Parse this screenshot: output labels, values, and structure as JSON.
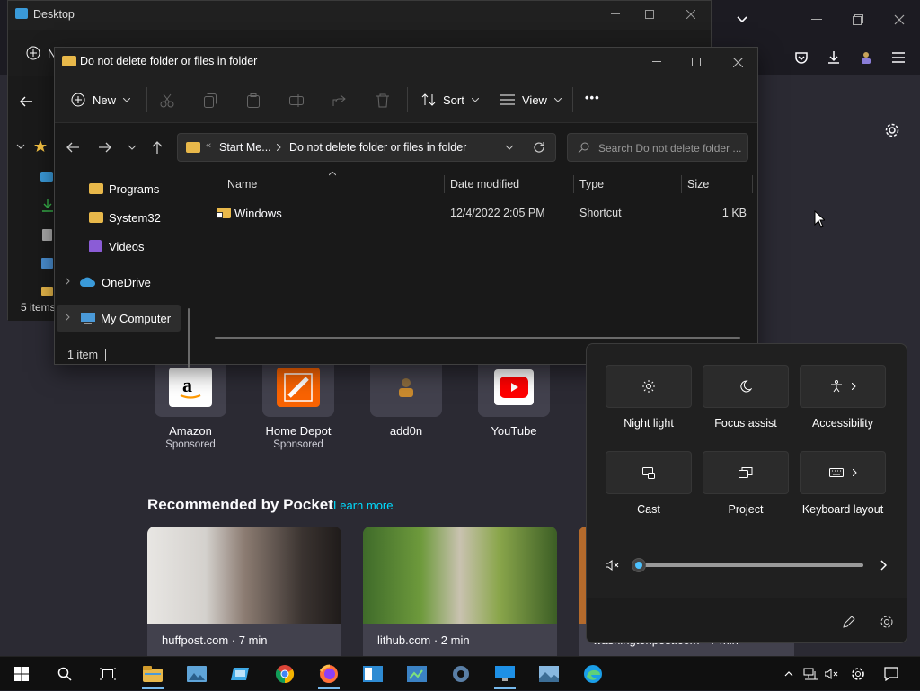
{
  "firefox": {
    "shortcuts": [
      {
        "title": "Amazon",
        "sub": "Sponsored"
      },
      {
        "title": "Home Depot",
        "sub": "Sponsored"
      },
      {
        "title": "add0n",
        "sub": ""
      },
      {
        "title": "YouTube",
        "sub": ""
      }
    ],
    "pocket": {
      "heading": "Recommended by Pocket",
      "learn_more": "Learn more",
      "cards": [
        {
          "source": "huffpost.com · 7 min"
        },
        {
          "source": "lithub.com · 2 min"
        },
        {
          "source": "washingtonpost.com · 7 min"
        }
      ]
    }
  },
  "desktop_window": {
    "title": "Desktop",
    "status": "5 items",
    "new_label": "N"
  },
  "explorer": {
    "title": "Do not delete folder or files in folder",
    "toolbar": {
      "new_label": "New",
      "sort_label": "Sort",
      "view_label": "View",
      "more_label": "•••"
    },
    "breadcrumb": {
      "overflow": "«",
      "part1": "Start Me...",
      "part2": "Do not delete folder or files in folder"
    },
    "search_placeholder": "Search Do not delete folder ...",
    "nav": [
      {
        "label": "Programs",
        "icon": "folder-icon"
      },
      {
        "label": "System32",
        "icon": "folder-icon"
      },
      {
        "label": "Videos",
        "icon": "videos-icon"
      },
      {
        "label": "OneDrive",
        "icon": "onedrive-icon"
      },
      {
        "label": "My Computer",
        "icon": "computer-icon"
      }
    ],
    "columns": {
      "name": "Name",
      "date": "Date modified",
      "type": "Type",
      "size": "Size"
    },
    "files": [
      {
        "name": "Windows",
        "date": "12/4/2022 2:05 PM",
        "type": "Shortcut",
        "size": "1 KB"
      }
    ],
    "status": "1 item"
  },
  "quick_settings": {
    "tiles": [
      {
        "label": "Night light",
        "icon": "night-light-icon",
        "chevron": false
      },
      {
        "label": "Focus assist",
        "icon": "moon-icon",
        "chevron": false
      },
      {
        "label": "Accessibility",
        "icon": "accessibility-icon",
        "chevron": true
      },
      {
        "label": "Cast",
        "icon": "cast-icon",
        "chevron": false
      },
      {
        "label": "Project",
        "icon": "project-icon",
        "chevron": false
      },
      {
        "label": "Keyboard layout",
        "icon": "keyboard-icon",
        "chevron": true
      }
    ],
    "volume": 0,
    "accent": "#4cc2ff"
  },
  "taskbar": {
    "apps": [
      "file-explorer-icon",
      "photos-icon",
      "remote-desktop-icon",
      "chrome-icon",
      "firefox-icon",
      "app-icon",
      "control-panel-icon",
      "settings-icon",
      "desktop-icon",
      "image-viewer-icon",
      "edge-icon"
    ]
  }
}
